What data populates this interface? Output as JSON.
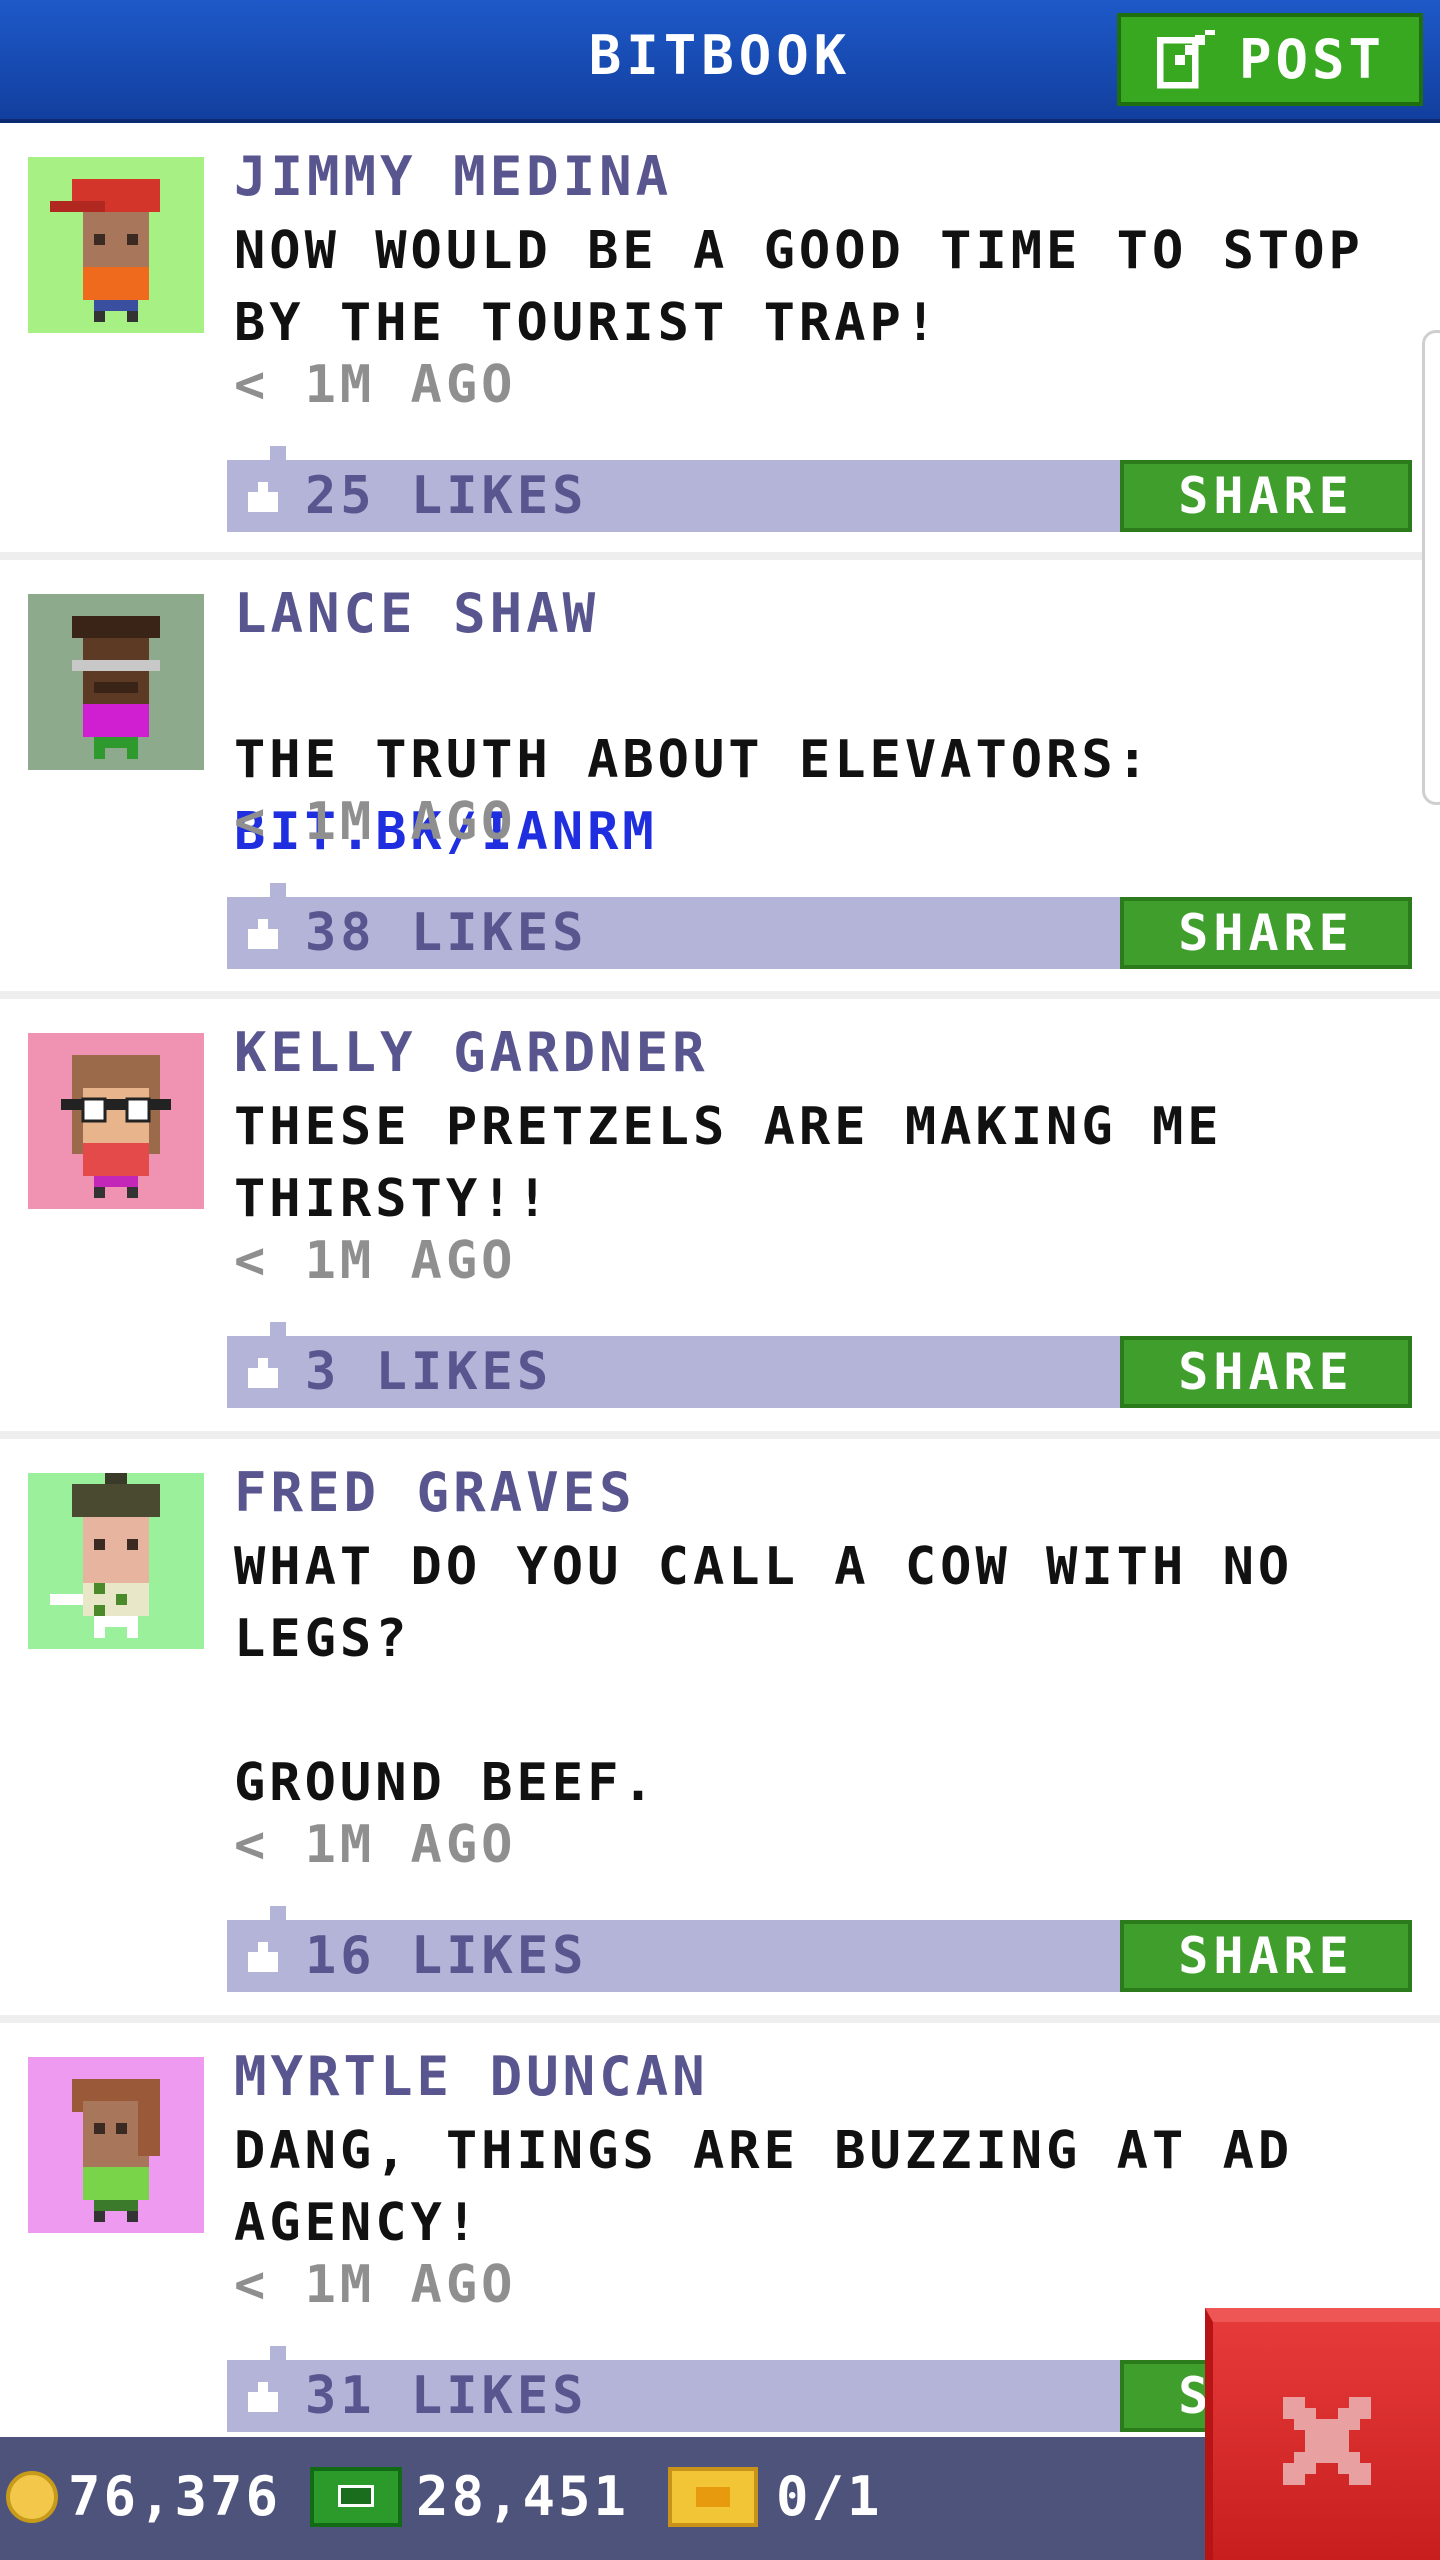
{
  "header": {
    "title": "BITBOOK",
    "post_label": "POST"
  },
  "posts": [
    {
      "author": "JIMMY MEDINA",
      "message": "NOW WOULD BE A GOOD TIME TO STOP BY THE TOURIST TRAP!",
      "link": "",
      "time": "< 1M AGO",
      "likes": "25 LIKES",
      "share": "SHARE"
    },
    {
      "author": "LANCE SHAW",
      "message": "THE TRUTH ABOUT ELEVATORS:",
      "link": "BIT.BK/IANRM",
      "time": "< 1M AGO",
      "likes": "38 LIKES",
      "share": "SHARE"
    },
    {
      "author": "KELLY GARDNER",
      "message": "THESE PRETZELS ARE MAKING ME THIRSTY!!",
      "link": "",
      "time": "< 1M AGO",
      "likes": "3 LIKES",
      "share": "SHARE"
    },
    {
      "author": "FRED GRAVES",
      "message": "WHAT DO YOU CALL A COW WITH NO LEGS?\n\nGROUND BEEF.",
      "link": "",
      "time": "< 1M AGO",
      "likes": "16 LIKES",
      "share": "SHARE"
    },
    {
      "author": "MYRTLE DUNCAN",
      "message": "DANG, THINGS ARE BUZZING AT AD AGENCY!",
      "link": "",
      "time": "< 1M AGO",
      "likes": "31 LIKES",
      "share": "SHARE"
    }
  ],
  "footer": {
    "coins": "76,376",
    "bux": "28,451",
    "tickets": "0/1"
  },
  "icons": {
    "post": "edit-icon",
    "like": "thumbs-up-icon",
    "coin": "coin-icon",
    "bux": "bux-icon",
    "tickets": "ticket-icon",
    "close": "close-icon"
  },
  "colors": {
    "header": "#1e59c9",
    "post_button": "#37a81f",
    "share_button": "#3f9e2c",
    "like_bar": "#b3b4d8",
    "author_text": "#58558f",
    "link_text": "#1f2fe0",
    "bottom_bar": "#4e537c",
    "close_button": "#d62b2b",
    "avatar_backgrounds": [
      "#a7f083",
      "#8eaa8c",
      "#f093b3",
      "#9af09b",
      "#ee9af0"
    ]
  }
}
